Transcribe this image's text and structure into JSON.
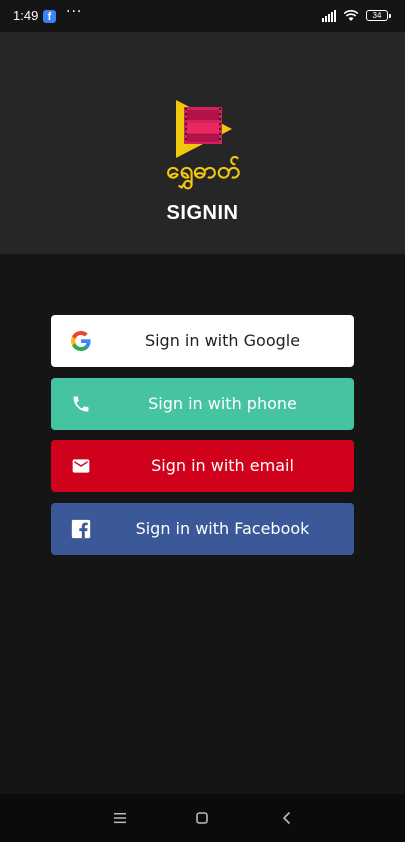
{
  "status_bar": {
    "time": "1:49",
    "notification_icon": "facebook-icon",
    "more_indicator": "···",
    "battery_level": "34"
  },
  "header": {
    "logo_text": "ရွှေဓာတ်",
    "title": "SIGNIN",
    "logo_colors": {
      "play_triangle": "#f2c80f",
      "film": "#d61f5c",
      "text": "#f2c80f"
    }
  },
  "sign_in_options": [
    {
      "label": "Sign in with Google",
      "icon": "google-icon",
      "color": "#ffffff",
      "text_color": "#222222"
    },
    {
      "label": "Sign in with phone",
      "icon": "phone-icon",
      "color": "#46c3a1",
      "text_color": "#ffffff"
    },
    {
      "label": "Sign in with email",
      "icon": "email-icon",
      "color": "#d0021b",
      "text_color": "#ffffff"
    },
    {
      "label": "Sign in with Facebook",
      "icon": "facebook-icon",
      "color": "#3b5998",
      "text_color": "#ffffff"
    }
  ],
  "nav_bar": {
    "buttons": [
      "menu-icon",
      "home-icon",
      "back-icon"
    ]
  },
  "colors": {
    "background": "#151515",
    "header_background": "#262626",
    "nav_background": "#0b0b0b"
  }
}
